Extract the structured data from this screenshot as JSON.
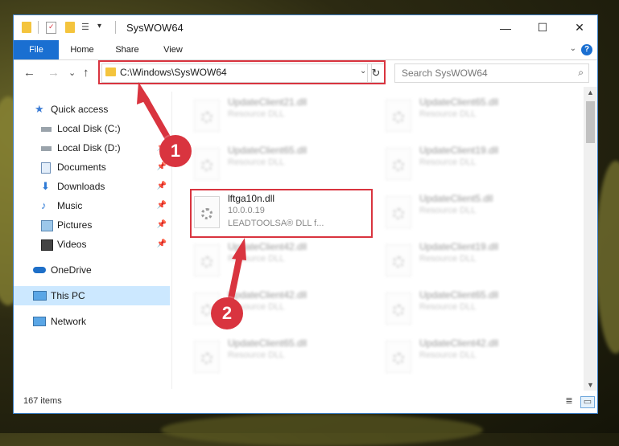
{
  "window": {
    "title": "SysWOW64",
    "controls": {
      "minimize": "—",
      "maximize": "☐",
      "close": "✕"
    }
  },
  "ribbon": {
    "tabs": [
      "File",
      "Home",
      "Share",
      "View"
    ],
    "help": "?",
    "expand": "⌄"
  },
  "nav": {
    "back": "←",
    "forward": "→",
    "recent": "⌄",
    "up": "↑",
    "address": "C:\\Windows\\SysWOW64",
    "address_dropdown": "⌄",
    "refresh": "↻",
    "search_placeholder": "Search SysWOW64",
    "search_icon": "⌕"
  },
  "sidebar": {
    "items": [
      {
        "label": "Quick access",
        "icon": "star-icon",
        "pinned": false
      },
      {
        "label": "Local Disk (C:)",
        "icon": "drive-icon",
        "pinned": false
      },
      {
        "label": "Local Disk (D:)",
        "icon": "drive-icon",
        "pinned": true
      },
      {
        "label": "Documents",
        "icon": "documents-icon",
        "pinned": true
      },
      {
        "label": "Downloads",
        "icon": "downloads-icon",
        "pinned": true
      },
      {
        "label": "Music",
        "icon": "music-icon",
        "pinned": true
      },
      {
        "label": "Pictures",
        "icon": "pictures-icon",
        "pinned": true
      },
      {
        "label": "Videos",
        "icon": "videos-icon",
        "pinned": true
      },
      {
        "label": "OneDrive",
        "icon": "onedrive-icon",
        "pinned": false
      },
      {
        "label": "This PC",
        "icon": "computer-icon",
        "pinned": false
      },
      {
        "label": "Network",
        "icon": "network-icon",
        "pinned": false
      }
    ]
  },
  "files": [
    {
      "name": "UpdateClient21.dll",
      "type": "Resource DLL"
    },
    {
      "name": "UpdateClient65.dll",
      "type": "Resource DLL"
    },
    {
      "name": "UpdateClient65.dll",
      "type": "Resource DLL"
    },
    {
      "name": "UpdateClient19.dll",
      "type": "Resource DLL"
    },
    {
      "name": "lftga10n.dll",
      "version": "10.0.0.19",
      "description": "LEADTOOLSA® DLL f..."
    },
    {
      "name": "UpdateClient5.dll",
      "type": "Resource DLL"
    },
    {
      "name": "UpdateClient42.dll",
      "type": "Resource DLL"
    },
    {
      "name": "UpdateClient19.dll",
      "type": "Resource DLL"
    },
    {
      "name": "UpdateClient42.dll",
      "type": "Resource DLL"
    },
    {
      "name": "UpdateClient65.dll",
      "type": "Resource DLL"
    },
    {
      "name": "UpdateClient65.dll",
      "type": "Resource DLL"
    },
    {
      "name": "UpdateClient42.dll",
      "type": "Resource DLL"
    }
  ],
  "status": {
    "item_count": "167 items",
    "details_view_icon": "≣",
    "large_icons_view_icon": "▭"
  },
  "annotations": {
    "step1": "1",
    "step2": "2",
    "color": "#d9343f"
  }
}
